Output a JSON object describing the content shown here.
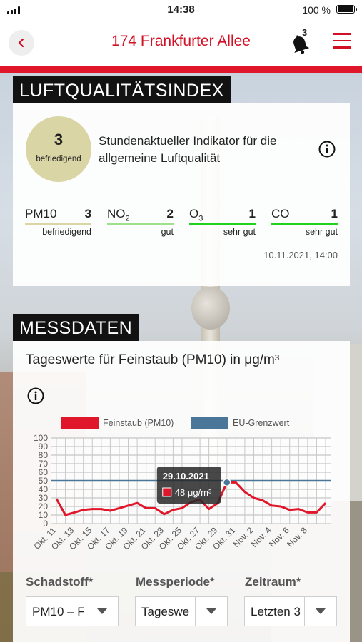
{
  "status_bar": {
    "time": "14:38",
    "battery": "100 %"
  },
  "header": {
    "title": "174 Frankfurter Allee",
    "notification_count": "3"
  },
  "air_quality": {
    "section_title": "LUFTQUALITÄTSINDEX",
    "index_value": "3",
    "index_label": "befriedigend",
    "description": "Stundenaktueller Indikator für die allgemeine Luftqualität",
    "pollutants": [
      {
        "name": "PM10",
        "value": "3",
        "rating": "befriedigend",
        "color": "#d9d5a4"
      },
      {
        "name": "NO",
        "sub": "2",
        "value": "2",
        "rating": "gut",
        "color": "#9fe08a"
      },
      {
        "name": "O",
        "sub": "3",
        "value": "1",
        "rating": "sehr gut",
        "color": "#22d11d"
      },
      {
        "name": "CO",
        "value": "1",
        "rating": "sehr gut",
        "color": "#22d11d"
      }
    ],
    "timestamp": "10.11.2021, 14:00"
  },
  "measurements": {
    "section_title": "MESSDATEN",
    "chart_title": "Tageswerte für Feinstaub (PM10) in μg/m³",
    "filters": [
      {
        "label": "Schadstoff*",
        "value": "PM10 – F"
      },
      {
        "label": "Messperiode*",
        "value": "Tageswe"
      },
      {
        "label": "Zeitraum*",
        "value": "Letzten 3"
      }
    ]
  },
  "chart_data": {
    "type": "line",
    "series": [
      {
        "name": "Feinstaub (PM10)",
        "color": "#e0172b",
        "values": [
          29,
          10,
          13,
          16,
          17,
          17,
          15,
          18,
          21,
          24,
          18,
          18,
          11,
          16,
          18,
          25,
          28,
          17,
          24,
          48,
          48,
          37,
          30,
          27,
          21,
          20,
          16,
          17,
          13,
          13,
          24
        ]
      },
      {
        "name": "EU-Grenzwert",
        "color": "#4a7699",
        "values": [
          50
        ]
      }
    ],
    "x_tick_labels": [
      "Okt. 11",
      "Okt. 13",
      "Okt. 15",
      "Okt. 17",
      "Okt. 19",
      "Okt. 21",
      "Okt. 23",
      "Okt. 25",
      "Okt. 27",
      "Okt. 29",
      "Okt. 31",
      "Nov. 2",
      "Nov. 4",
      "Nov. 6",
      "Nov. 8"
    ],
    "y_ticks": [
      0,
      10,
      20,
      30,
      40,
      50,
      60,
      70,
      80,
      90,
      100
    ],
    "ylim": [
      0,
      100
    ],
    "grid": true,
    "tooltip": {
      "date": "29.10.2021",
      "value": "48 μg/m³"
    }
  }
}
